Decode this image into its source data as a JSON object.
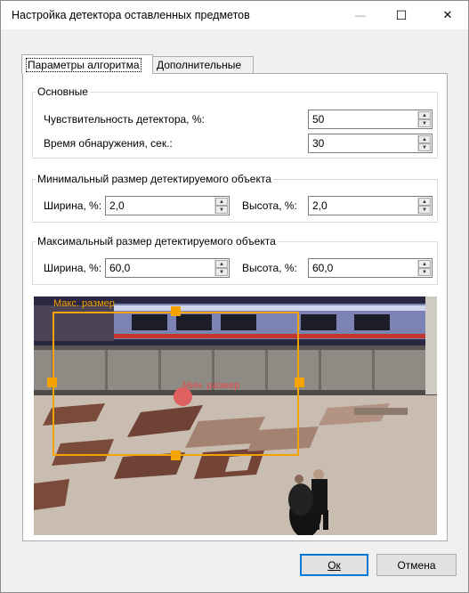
{
  "window": {
    "title": "Настройка детектора оставленных предметов",
    "minimize_glyph": "—",
    "maximize_glyph": "☐",
    "close_glyph": "✕"
  },
  "tabs": [
    {
      "label": "Параметры алгоритма",
      "active": true
    },
    {
      "label": "Дополнительные",
      "active": false
    }
  ],
  "basic": {
    "title": "Основные",
    "sensitivity_label": "Чувствительность детектора, %:",
    "sensitivity_value": "50",
    "detection_time_label": "Время обнаружения, сек.:",
    "detection_time_value": "30"
  },
  "min_size": {
    "title": "Минимальный размер детектируемого объекта",
    "width_label": "Ширина, %:",
    "width_value": "2,0",
    "height_label": "Высота, %:",
    "height_value": "2,0"
  },
  "max_size": {
    "title": "Максимальный размер детектируемого объекта",
    "width_label": "Ширина, %:",
    "width_value": "60,0",
    "height_label": "Высота, %:",
    "height_value": "60,0"
  },
  "preview": {
    "max_label": "Макс. размер",
    "min_label": "Мин. размер",
    "max_color": "#f5a300",
    "min_color": "#e05050"
  },
  "buttons": {
    "ok": "Ок",
    "cancel": "Отмена"
  }
}
